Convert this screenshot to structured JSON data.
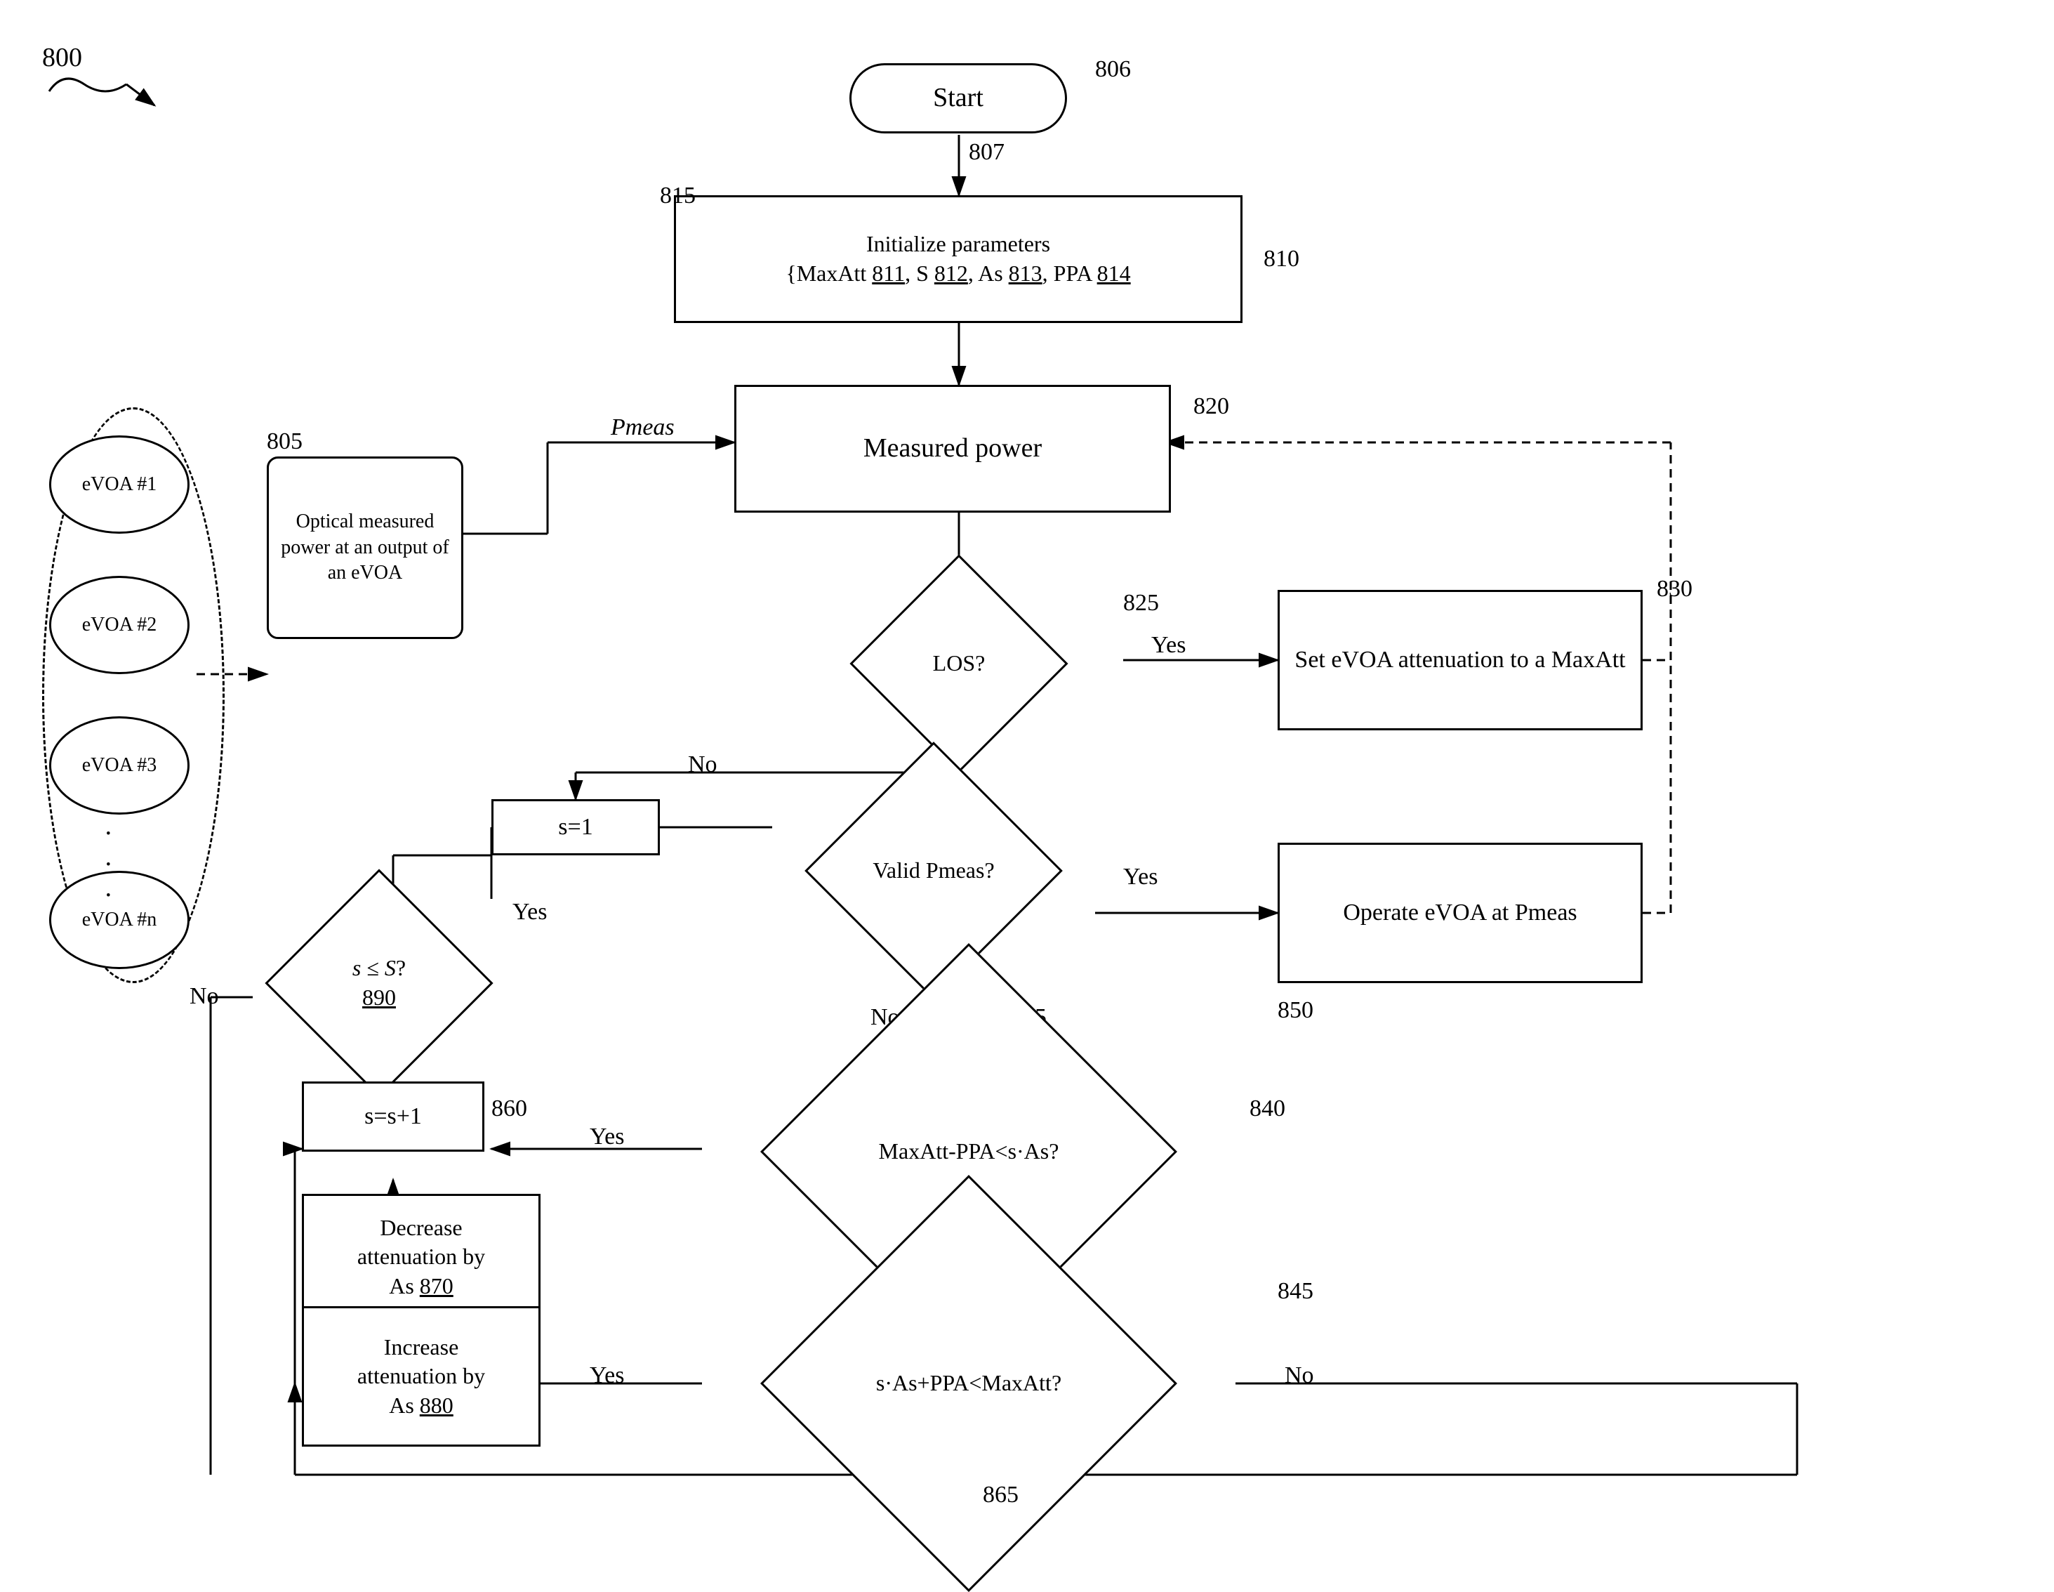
{
  "diagram": {
    "title": "800",
    "nodes": {
      "start": {
        "label": "Start",
        "ref": "806"
      },
      "init": {
        "label": "Initialize parameters\n{MaxAtt 811, S 812, As 813, PPA 814",
        "ref": "810",
        "ref2": "815"
      },
      "measured_power": {
        "label": "Measured power",
        "ref": "820",
        "pmeas": "Pmeas"
      },
      "los": {
        "label": "LOS?",
        "ref": "825"
      },
      "set_evoa": {
        "label": "Set eVOA attenuation to a MaxAtt",
        "ref": "830"
      },
      "s_eq_1": {
        "label": "s=1"
      },
      "s_leq_s": {
        "label": "s ≤ S?\n890",
        "ref": "890"
      },
      "valid_pmeas": {
        "label": "Valid Pmeas?",
        "ref": "835"
      },
      "operate_evoa": {
        "label": "Operate eVOA at Pmeas",
        "ref": "850"
      },
      "maxatt_check": {
        "label": "MaxAtt-PPA<s·As?",
        "ref": "840"
      },
      "s_eq_s1": {
        "label": "s=s+1",
        "ref": "860"
      },
      "decrease_att": {
        "label": "Decrease attenuation by As 870",
        "ref": "870"
      },
      "s_as_check": {
        "label": "s·As+PPA<MaxAtt?",
        "ref": "845"
      },
      "increase_att": {
        "label": "Increase attenuation by As 880",
        "ref": "880"
      },
      "evoa1": {
        "label": "eVOA\n#1"
      },
      "evoa2": {
        "label": "eVOA\n#2"
      },
      "evoa3": {
        "label": "eVOA\n#3"
      },
      "evoan": {
        "label": "eVOA\n#n"
      },
      "optical_note": {
        "label": "Optical\nmeasured\npower at an\noutput of an\neVOA",
        "ref": "805"
      }
    },
    "labels": {
      "yes": "Yes",
      "no": "No",
      "ref_807": "807",
      "ref_865": "865",
      "ref_806": "806",
      "ref_810": "810",
      "ref_820": "820",
      "ref_825": "825",
      "ref_830": "830",
      "ref_835": "835",
      "ref_840": "840",
      "ref_845": "845",
      "ref_850": "850",
      "ref_860": "860",
      "ref_865b": "865",
      "ref_870": "870",
      "ref_880": "880",
      "ref_890": "890",
      "ref_800": "800",
      "ref_805": "805",
      "ref_815": "815",
      "pmeas_label": "Pmeas"
    }
  }
}
